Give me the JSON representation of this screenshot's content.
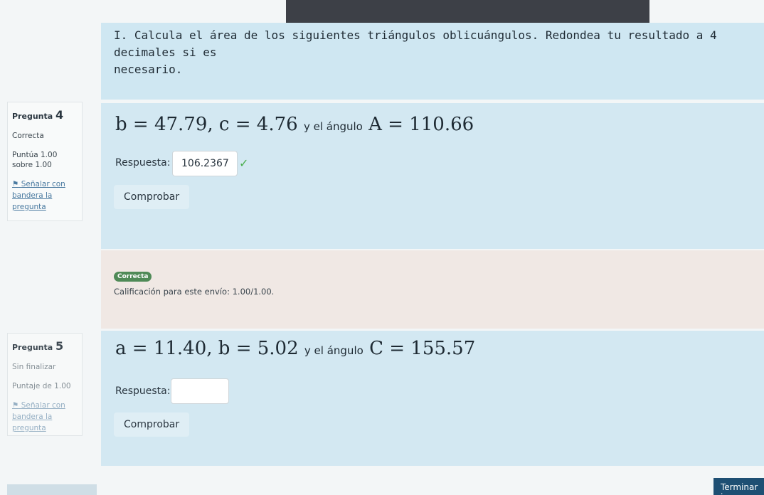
{
  "instructions": {
    "line1": "I. Calcula el área de los siguientes triángulos oblicuángulos. Redondea tu resultado a 4 decimales si es",
    "line2": "necesario."
  },
  "q4": {
    "label": "Pregunta",
    "number": "4",
    "state": "Correcta",
    "grade_line1": "Puntúa 1.00",
    "grade_line2": "sobre 1.00",
    "flag_line1": "Señalar con",
    "flag_line2": "bandera la",
    "flag_line3": "pregunta",
    "formula_part1": "b = 47.79,",
    "formula_part2": "c = 4.76",
    "formula_middle": "y el ángulo",
    "formula_part3": "A = 110.66",
    "answer_label": "Respuesta:",
    "answer_value": "106.2367",
    "check_button": "Comprobar",
    "feedback_badge": "Correcta",
    "feedback_text": "Calificación para este envío: 1.00/1.00."
  },
  "q5": {
    "label": "Pregunta",
    "number": "5",
    "state": "Sin finalizar",
    "grade_line1": "Puntaje de 1.00",
    "flag_line1": "Señalar con",
    "flag_line2": "bandera la",
    "flag_line3": "pregunta",
    "formula_part1": "a = 11.40,",
    "formula_part2": "b = 5.02",
    "formula_middle": "y el ángulo",
    "formula_part3": "C = 155.57",
    "answer_label": "Respuesta:",
    "answer_value": "",
    "check_button": "Comprobar"
  },
  "finish_button": "Terminar i",
  "icons": {
    "flag": "flag-icon",
    "check": "checkmark-icon"
  },
  "colors": {
    "content_bg": "#d3e8f2",
    "feedback_bg": "#f0e8e4",
    "correct_badge": "#4f8a57",
    "finish_button": "#1e4f73"
  }
}
